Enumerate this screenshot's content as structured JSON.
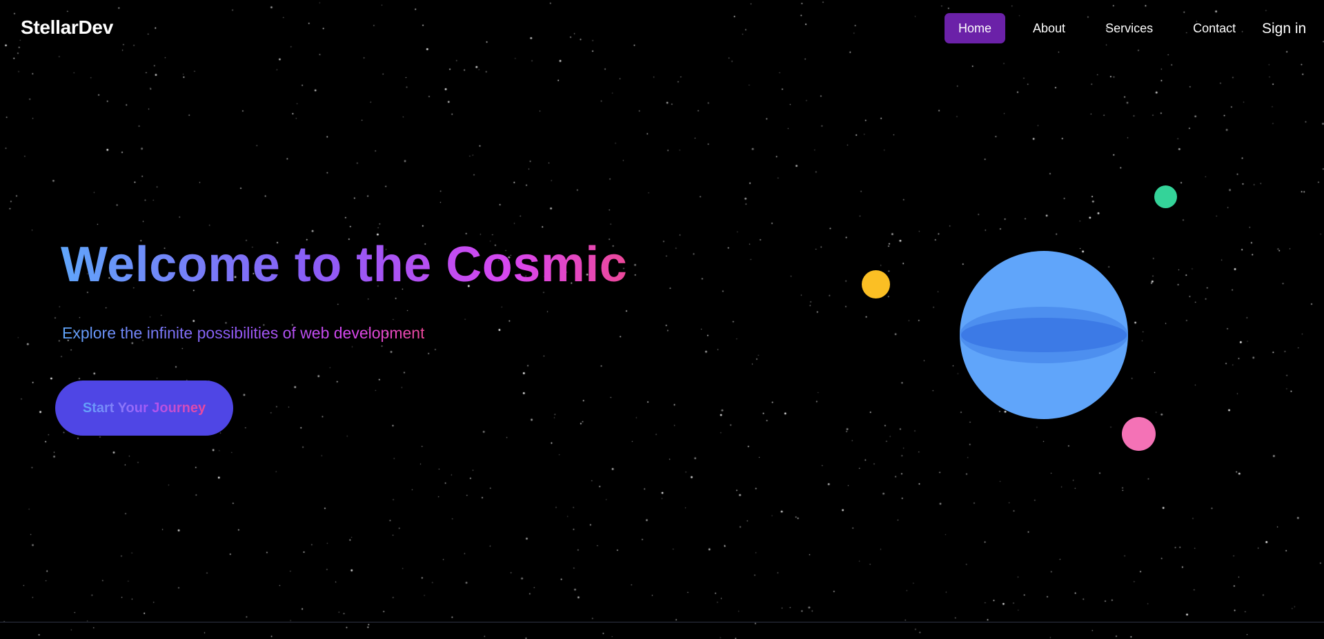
{
  "brand": {
    "name": "StellarDev"
  },
  "nav": {
    "links": [
      {
        "label": "Home",
        "active": true
      },
      {
        "label": "About",
        "active": false
      },
      {
        "label": "Services",
        "active": false
      },
      {
        "label": "Contact",
        "active": false
      }
    ],
    "signin_label": "Sign in"
  },
  "hero": {
    "title": "Welcome to the Cosmic",
    "subtitle": "Explore the infinite possibilities of web development",
    "cta_label": "Start Your Journey"
  },
  "colors": {
    "background": "#000000",
    "nav_active": "#6b21a8",
    "cta_background": "#4f46e5",
    "gradient_start": "#60a5fa",
    "gradient_mid": "#8b5cf6",
    "gradient_end": "#ec4899",
    "planet_main": "#60a5fa",
    "moon_yellow": "#fbbf24",
    "moon_green": "#34d399",
    "moon_pink": "#f472b6"
  }
}
